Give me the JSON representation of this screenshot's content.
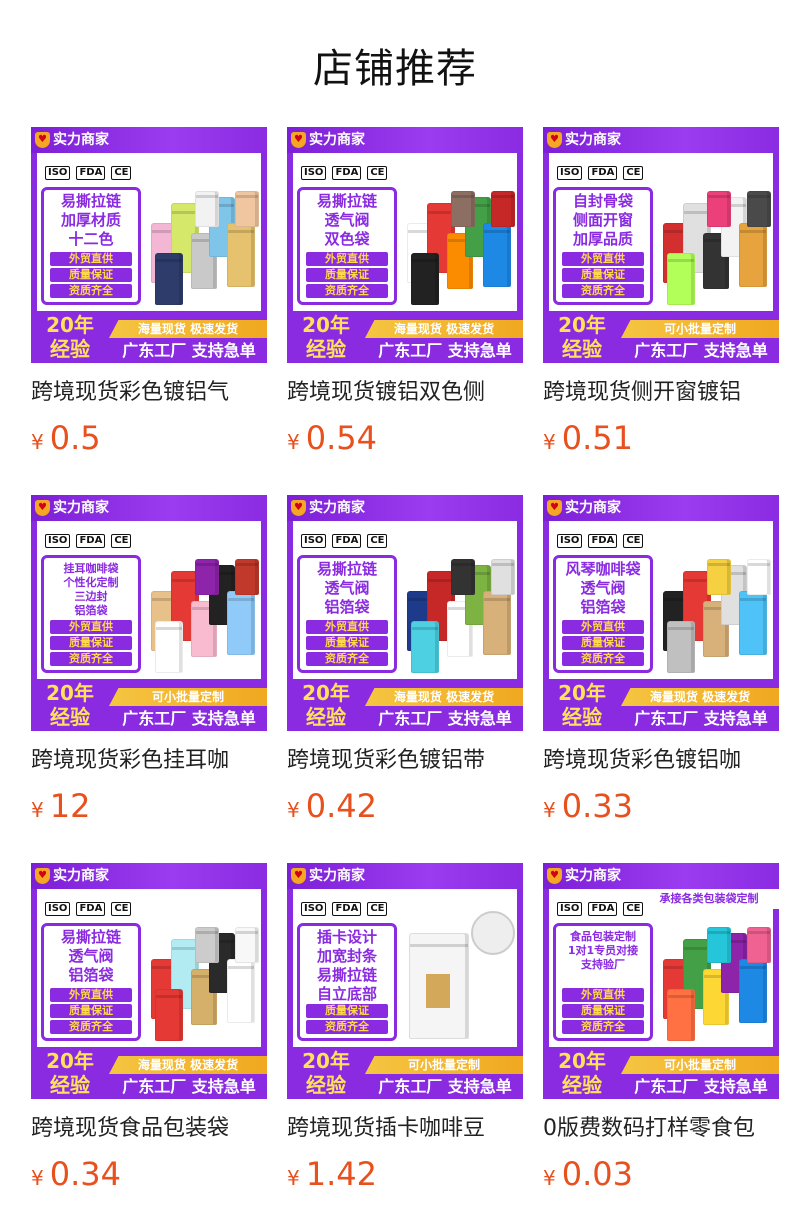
{
  "page": {
    "title": "店铺推荐"
  },
  "common": {
    "merchant_badge": "实力商家",
    "certs": [
      "ISO",
      "FDA",
      "CE"
    ],
    "years": "20年经验",
    "factory_line": "广东工厂 支持急单",
    "currency": "¥"
  },
  "colors": {
    "brand_purple": "#8a2be2",
    "price_orange": "#e8501e",
    "tag_yellow": "#ffd84a"
  },
  "products": [
    {
      "title": "跨境现货彩色镀铝气",
      "price": "0.5",
      "feature": [
        "易撕拉链",
        "加厚材质",
        "十二色"
      ],
      "small": false,
      "tags": [
        "外贸直供",
        "质量保证",
        "资质齐全"
      ],
      "promo": "海量现货 极速发货",
      "bag_colors": [
        "#f3b6d5",
        "#d5e86a",
        "#c9c9c9",
        "#7fc5ea",
        "#e7c26e",
        "#2d3c6a",
        "#f2f2f2",
        "#f0c6a0"
      ]
    },
    {
      "title": "跨境现货镀铝双色侧",
      "price": "0.54",
      "feature": [
        "易撕拉链",
        "透气阀",
        "双色袋"
      ],
      "small": false,
      "tags": [
        "外贸直供",
        "质量保证",
        "资质齐全"
      ],
      "promo": "海量现货 极速发货",
      "bag_colors": [
        "#ffffff",
        "#e53935",
        "#fb8c00",
        "#43a047",
        "#1e88e5",
        "#222222",
        "#8d6e63",
        "#c62828"
      ]
    },
    {
      "title": "跨境现货侧开窗镀铝",
      "price": "0.51",
      "feature": [
        "自封骨袋",
        "侧面开窗",
        "加厚品质"
      ],
      "small": false,
      "tags": [
        "外贸直供",
        "质量保证",
        "资质齐全"
      ],
      "promo": "可小批量定制",
      "bag_colors": [
        "#d32f2f",
        "#e0e0e0",
        "#333333",
        "#f3f3f3",
        "#e6a33e",
        "#b2ff59",
        "#ec407a",
        "#4a4a4a"
      ]
    },
    {
      "title": "跨境现货彩色挂耳咖",
      "price": "12",
      "feature": [
        "挂耳咖啡袋",
        "个性化定制",
        "三边封",
        "铝箔袋"
      ],
      "small": true,
      "tags": [
        "外贸直供",
        "质量保证",
        "资质齐全"
      ],
      "promo": "可小批量定制",
      "bag_colors": [
        "#e8c08a",
        "#e53935",
        "#f8bbd0",
        "#222222",
        "#90caf9",
        "#ffffff",
        "#8e24aa",
        "#c0392b"
      ]
    },
    {
      "title": "跨境现货彩色镀铝带",
      "price": "0.42",
      "feature": [
        "易撕拉链",
        "透气阀",
        "铝箔袋"
      ],
      "small": false,
      "tags": [
        "外贸直供",
        "质量保证",
        "资质齐全"
      ],
      "promo": "海量现货 极速发货",
      "bag_colors": [
        "#1e3a8a",
        "#c62828",
        "#ffffff",
        "#7cb342",
        "#d7b07a",
        "#4dd0e1",
        "#333333",
        "#e0e0e0"
      ]
    },
    {
      "title": "跨境现货彩色镀铝咖",
      "price": "0.33",
      "feature": [
        "风琴咖啡袋",
        "透气阀",
        "铝箔袋"
      ],
      "small": false,
      "tags": [
        "外贸直供",
        "质量保证",
        "资质齐全"
      ],
      "promo": "海量现货 极速发货",
      "bag_colors": [
        "#222222",
        "#e53935",
        "#d7b07a",
        "#e0e0e0",
        "#4fc3f7",
        "#c0c0c0",
        "#f5d142",
        "#ffffff"
      ]
    },
    {
      "title": "跨境现货食品包装袋",
      "price": "0.34",
      "feature": [
        "易撕拉链",
        "透气阀",
        "铝箔袋"
      ],
      "small": false,
      "tags": [
        "外贸直供",
        "质量保证",
        "资质齐全"
      ],
      "promo": "海量现货 极速发货",
      "bag_colors": [
        "#e53935",
        "#b2ebf2",
        "#d4b06a",
        "#2a2a2a",
        "#ffffff",
        "#e53935",
        "#cccccc",
        "#f8f8f8"
      ]
    },
    {
      "title": "跨境现货插卡咖啡豆",
      "price": "1.42",
      "feature": [
        "插卡设计",
        "加宽封条",
        "易撕拉链",
        "自立底部"
      ],
      "small": false,
      "tags": [
        "质量保证",
        "资质齐全"
      ],
      "promo": "可小批量定制",
      "bag_colors": [
        "#f5f5f5",
        "#d4a85a"
      ]
    },
    {
      "title": "0版费数码打样零食包",
      "price": "0.03",
      "feature": [
        "食品包装定制",
        "1对1专员对接",
        "支持验厂"
      ],
      "small": true,
      "tags": [
        "外贸直供",
        "质量保证",
        "资质齐全"
      ],
      "promo": "可小批量定制",
      "top_promo": "承接各类包装袋定制",
      "bag_colors": [
        "#e53935",
        "#43a047",
        "#fdd835",
        "#8e24aa",
        "#1e88e5",
        "#ff7043",
        "#26c6da",
        "#f06292"
      ]
    }
  ]
}
